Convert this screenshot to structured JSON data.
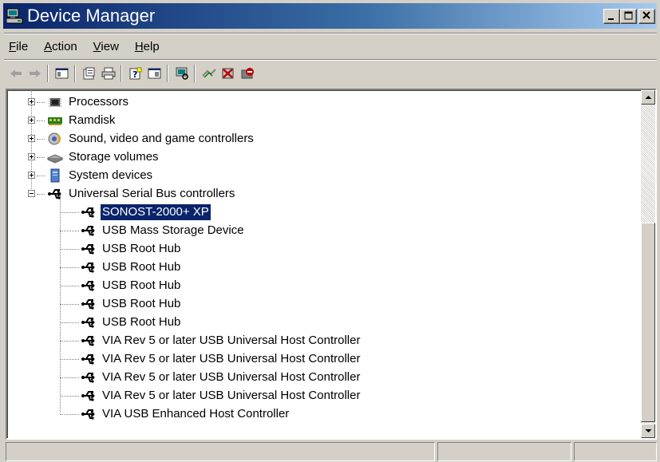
{
  "window": {
    "title": "Device Manager",
    "controls": {
      "minimize": "minimize-icon",
      "maximize": "maximize-icon",
      "close": "close-icon"
    }
  },
  "menu": [
    {
      "label": "File",
      "accel": "F",
      "rest": "ile"
    },
    {
      "label": "Action",
      "accel": "A",
      "rest": "ction"
    },
    {
      "label": "View",
      "accel": "V",
      "rest": "iew"
    },
    {
      "label": "Help",
      "accel": "H",
      "rest": "elp"
    }
  ],
  "toolbar": [
    "back-arrow-icon",
    "forward-arrow-icon",
    "show-hide-tree-icon",
    "properties-icon",
    "print-icon",
    "help-icon",
    "show-hide-action-pane-icon",
    "scan-hardware-icon",
    "update-driver-icon",
    "uninstall-icon",
    "disable-icon"
  ],
  "tree": {
    "categories": [
      {
        "label": "Processors",
        "icon": "processor-icon",
        "expanded": false
      },
      {
        "label": "Ramdisk",
        "icon": "ramdisk-icon",
        "expanded": false
      },
      {
        "label": "Sound, video and game controllers",
        "icon": "sound-icon",
        "expanded": false
      },
      {
        "label": "Storage volumes",
        "icon": "storage-volume-icon",
        "expanded": false
      },
      {
        "label": "System devices",
        "icon": "system-devices-icon",
        "expanded": false
      },
      {
        "label": "Universal Serial Bus controllers",
        "icon": "usb-icon",
        "expanded": true
      }
    ],
    "usb_children": [
      {
        "label": "SONOST-2000+ XP",
        "selected": true
      },
      {
        "label": "USB Mass Storage Device"
      },
      {
        "label": "USB Root Hub"
      },
      {
        "label": "USB Root Hub"
      },
      {
        "label": "USB Root Hub"
      },
      {
        "label": "USB Root Hub"
      },
      {
        "label": "USB Root Hub"
      },
      {
        "label": "VIA Rev 5 or later USB Universal Host Controller"
      },
      {
        "label": "VIA Rev 5 or later USB Universal Host Controller"
      },
      {
        "label": "VIA Rev 5 or later USB Universal Host Controller"
      },
      {
        "label": "VIA Rev 5 or later USB Universal Host Controller"
      },
      {
        "label": "VIA USB Enhanced Host Controller"
      }
    ]
  },
  "colors": {
    "title_gradient_start": "#0a246a",
    "title_gradient_end": "#a6caf0",
    "selection": "#0a246a",
    "face": "#d4d0c8"
  }
}
